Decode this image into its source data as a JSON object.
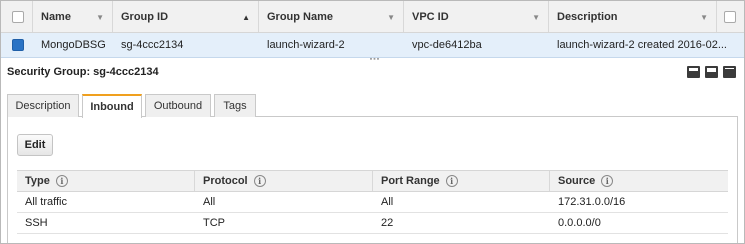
{
  "list_table": {
    "columns": [
      {
        "label": "Name",
        "sort": "desc-arrow"
      },
      {
        "label": "Group ID",
        "sort": "asc-arrow"
      },
      {
        "label": "Group Name",
        "sort": "desc-arrow"
      },
      {
        "label": "VPC ID",
        "sort": "desc-arrow"
      },
      {
        "label": "Description",
        "sort": "desc-arrow"
      }
    ],
    "sort_glyphs": {
      "asc": "▲",
      "desc": "▼"
    },
    "rows": [
      {
        "selected": true,
        "name": "MongoDBSG",
        "group_id": "sg-4ccc2134",
        "group_name": "launch-wizard-2",
        "vpc_id": "vpc-de6412ba",
        "description": "launch-wizard-2 created 2016-02..."
      }
    ]
  },
  "detail": {
    "resize_grip": "▪▪▪",
    "title": "Security Group: sg-4ccc2134",
    "layout_icons": [
      "panel-bottom-icon",
      "panel-split-icon",
      "panel-full-icon"
    ],
    "tabs": [
      "Description",
      "Inbound",
      "Outbound",
      "Tags"
    ],
    "active_tab": "Inbound",
    "edit_label": "Edit",
    "rules": {
      "info_glyph": "i",
      "columns": [
        "Type",
        "Protocol",
        "Port Range",
        "Source"
      ],
      "rows": [
        {
          "type": "All traffic",
          "protocol": "All",
          "port_range": "All",
          "source": "172.31.0.0/16"
        },
        {
          "type": "SSH",
          "protocol": "TCP",
          "port_range": "22",
          "source": "0.0.0.0/0"
        }
      ]
    }
  },
  "colors": {
    "selected_row": "#e4effa",
    "checkbox_checked": "#2a73c5",
    "active_tab_accent": "#f0a01e"
  }
}
